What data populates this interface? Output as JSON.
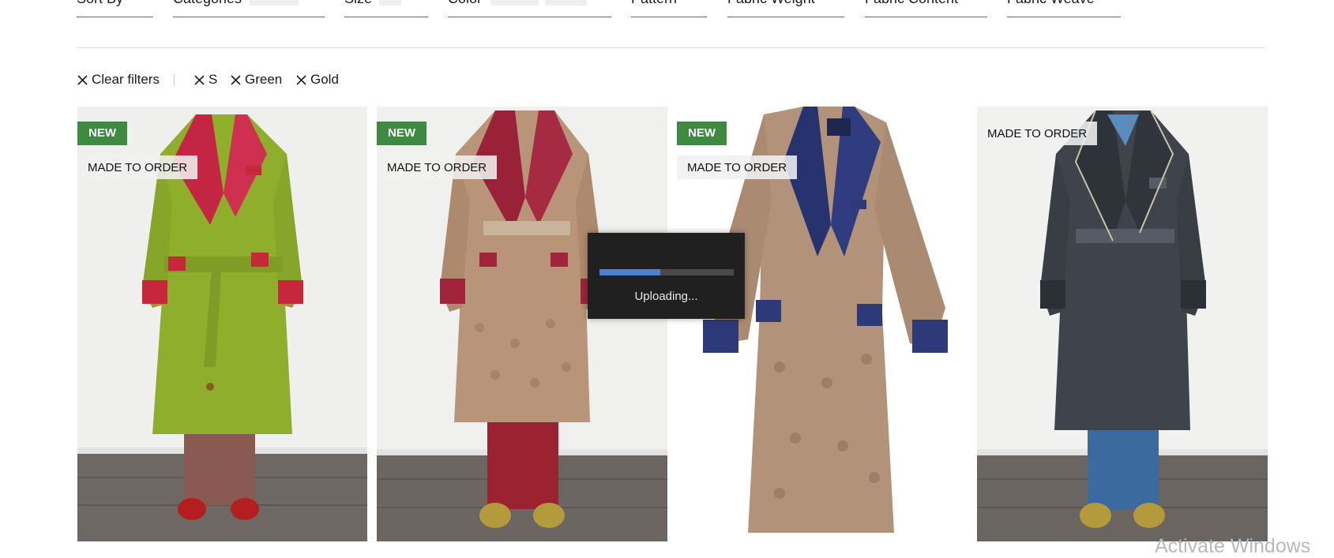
{
  "filters": [
    {
      "label": "Sort By"
    },
    {
      "label": "Categories"
    },
    {
      "label": "Size"
    },
    {
      "label": "Color"
    },
    {
      "label": "Pattern"
    },
    {
      "label": "Fabric Weight"
    },
    {
      "label": "Fabric Content"
    },
    {
      "label": "Fabric Weave"
    }
  ],
  "active_filters": {
    "clear_label": "Clear filters",
    "chips": [
      "S",
      "Green",
      "Gold"
    ]
  },
  "products": [
    {
      "badge_new": "NEW",
      "badge_made_to_order": "MADE TO ORDER"
    },
    {
      "badge_new": "NEW",
      "badge_made_to_order": "MADE TO ORDER"
    },
    {
      "badge_new": "NEW",
      "badge_made_to_order": "MADE TO ORDER"
    },
    {
      "badge_made_to_order": "MADE TO ORDER"
    }
  ],
  "upload_dialog": {
    "status_text": "Uploading...",
    "progress": 0.45
  },
  "watermark": "Activate Windows",
  "colors": {
    "new_badge": "#3d8b40",
    "progress_fill": "#4f7fd2",
    "modal_bg": "#202020"
  }
}
